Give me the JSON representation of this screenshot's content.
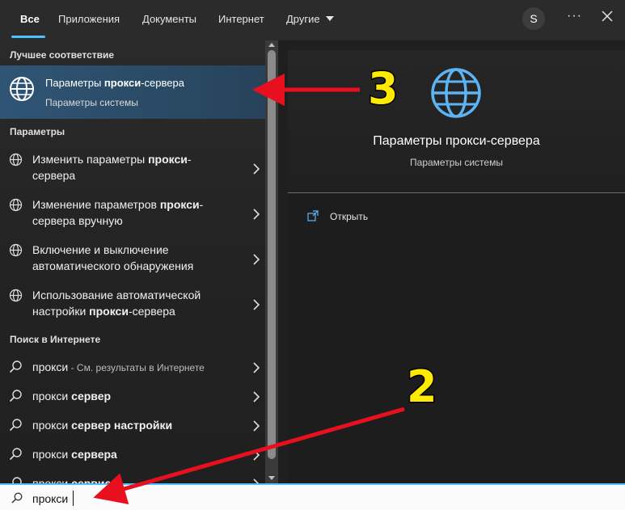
{
  "tabs": [
    "Все",
    "Приложения",
    "Документы",
    "Интернет",
    "Другие"
  ],
  "avatar_letter": "S",
  "more_glyph": "···",
  "left": {
    "best_match_header": "Лучшее соответствие",
    "best": {
      "title_pre": "Параметры ",
      "title_bold": "прокси",
      "title_post": "-сервера",
      "subtitle": "Параметры системы"
    },
    "settings_header": "Параметры",
    "settings": [
      {
        "l1_pre": "Изменить параметры ",
        "l1_bold": "прокси",
        "l1_post": "-",
        "l2_pre": "сервера",
        "l2_bold": "",
        "l2_post": ""
      },
      {
        "l1_pre": "Изменение параметров ",
        "l1_bold": "прокси",
        "l1_post": "-",
        "l2_pre": "сервера вручную",
        "l2_bold": "",
        "l2_post": ""
      },
      {
        "l1_pre": "Включение и выключение",
        "l1_bold": "",
        "l1_post": "",
        "l2_pre": "автоматического обнаружения",
        "l2_bold": "",
        "l2_post": ""
      },
      {
        "l1_pre": "Использование автоматической",
        "l1_bold": "",
        "l1_post": "",
        "l2_pre": "настройки ",
        "l2_bold": "прокси",
        "l2_post": "-сервера"
      }
    ],
    "web_header": "Поиск в Интернете",
    "web": [
      {
        "pre": "прокси",
        "bold": "",
        "hint": " - См. результаты в Интернете"
      },
      {
        "pre": "прокси ",
        "bold": "сервер",
        "hint": ""
      },
      {
        "pre": "прокси ",
        "bold": "сервер настройки",
        "hint": ""
      },
      {
        "pre": "прокси ",
        "bold": "сервера",
        "hint": ""
      },
      {
        "pre": "прокси ",
        "bold": "сервис",
        "hint": ""
      }
    ]
  },
  "right": {
    "title": "Параметры прокси-сервера",
    "subtitle": "Параметры системы",
    "open_label": "Открыть"
  },
  "search": {
    "value": "прокси"
  },
  "annotations": {
    "label_3": "3",
    "label_2": "2",
    "color": "#e8101e"
  }
}
